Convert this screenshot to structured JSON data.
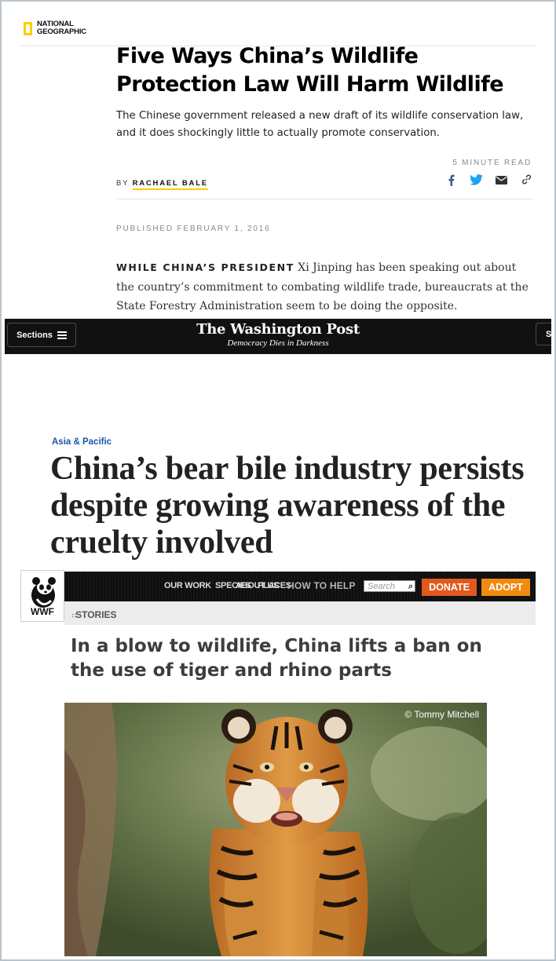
{
  "natgeo": {
    "logo_line1": "NATIONAL",
    "logo_line2": "GEOGRAPHIC",
    "title": "Five Ways China’s Wildlife Protection Law Will Harm Wildlife",
    "dek": "The Chinese government released a new draft of its wildlife conservation law, and it does shockingly little to actually promote conservation.",
    "read_time": "5 MINUTE READ",
    "by_label": "BY",
    "author": "RACHAEL BALE",
    "share_icons": [
      "facebook-icon",
      "twitter-icon",
      "email-icon",
      "link-icon"
    ],
    "published": "PUBLISHED FEBRUARY 1, 2016",
    "body_leadin": "WHILE CHINA’S PRESIDENT",
    "body_text": " Xi Jinping has been speaking out about the country’s commitment to combating wildlife trade, bureaucrats at the State Forestry Administration seem to be doing the opposite."
  },
  "wapo": {
    "sections_label": "Sections",
    "masthead": "The Washington Post",
    "tagline": "Democracy Dies in Darkness",
    "right_button": "Si",
    "kicker": "Asia & Pacific",
    "headline": "China’s bear bile industry persists despite growing awareness of the cruelty involved"
  },
  "wwf": {
    "logo_text": "WWF",
    "nav": {
      "our_work": "OUR WORK",
      "species": "SPECIES",
      "about_us": "ABOUT US",
      "places": "PLACES",
      "how_to_help": "HOW TO HELP"
    },
    "search_placeholder": "Search",
    "donate": "DONATE",
    "adopt": "ADOPT",
    "stories": "STORIES",
    "headline": "In a blow to wildlife, China lifts a ban on the use of tiger and rhino parts",
    "photo_credit": "© Tommy Mitchell"
  },
  "colors": {
    "natgeo_yellow": "#ffcc00",
    "wapo_kicker": "#1955a5",
    "wwf_donate": "#e05a1e",
    "wwf_adopt": "#f08a11",
    "twitter_blue": "#1da1f2",
    "facebook_blue": "#3b5998"
  }
}
